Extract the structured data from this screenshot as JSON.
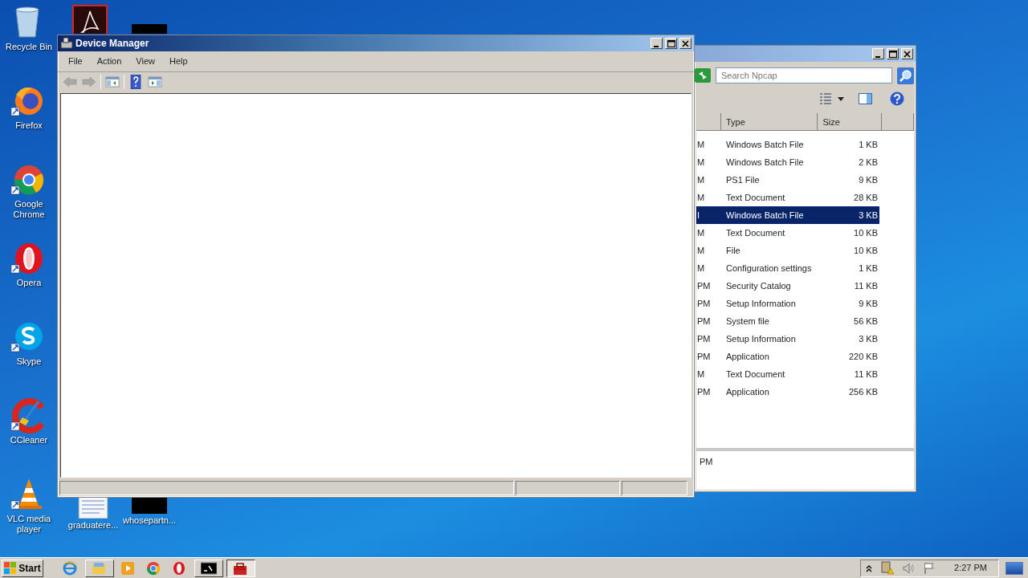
{
  "desktop_icons": [
    {
      "kind": "recycle",
      "label": "Recycle Bin"
    },
    {
      "kind": "firefox",
      "label": "Firefox"
    },
    {
      "kind": "chrome",
      "label": "Google Chrome"
    },
    {
      "kind": "opera",
      "label": "Opera"
    },
    {
      "kind": "skype",
      "label": "Skype"
    },
    {
      "kind": "ccleaner",
      "label": "CCleaner"
    },
    {
      "kind": "vlc",
      "label": "VLC media player"
    }
  ],
  "desktop_icons_2": [
    {
      "kind": "pdf"
    },
    {
      "kind": "thumb"
    },
    {
      "kind": "document",
      "label": "graduatere..."
    },
    {
      "kind": "thumb",
      "label": "whosepartn..."
    }
  ],
  "explorer": {
    "search": {
      "placeholder": "Search Npcap"
    },
    "columns": [
      "Type",
      "Size"
    ],
    "rows": [
      {
        "column_1": "M",
        "type": "Windows Batch File",
        "size": "1 KB",
        "selected": false
      },
      {
        "column_1": "M",
        "type": "Windows Batch File",
        "size": "2 KB",
        "selected": false
      },
      {
        "column_1": "M",
        "type": "PS1 File",
        "size": "9 KB",
        "selected": false
      },
      {
        "column_1": "M",
        "type": "Text Document",
        "size": "28 KB",
        "selected": false
      },
      {
        "column_1": "I",
        "type": "Windows Batch File",
        "size": "3 KB",
        "selected": true
      },
      {
        "column_1": "M",
        "type": "Text Document",
        "size": "10 KB",
        "selected": false
      },
      {
        "column_1": "M",
        "type": "File",
        "size": "10 KB",
        "selected": false
      },
      {
        "column_1": "M",
        "type": "Configuration settings",
        "size": "1 KB",
        "selected": false
      },
      {
        "column_1": "PM",
        "type": "Security Catalog",
        "size": "11 KB",
        "selected": false
      },
      {
        "column_1": "PM",
        "type": "Setup Information",
        "size": "9 KB",
        "selected": false
      },
      {
        "column_1": "PM",
        "type": "System file",
        "size": "56 KB",
        "selected": false
      },
      {
        "column_1": "PM",
        "type": "Setup Information",
        "size": "3 KB",
        "selected": false
      },
      {
        "column_1": "PM",
        "type": "Application",
        "size": "220 KB",
        "selected": false
      },
      {
        "column_1": "M",
        "type": "Text Document",
        "size": "11 KB",
        "selected": false
      },
      {
        "column_1": "PM",
        "type": "Application",
        "size": "256 KB",
        "selected": false
      }
    ],
    "details": "PM"
  },
  "device_manager": {
    "title": "Device Manager",
    "menu": [
      "File",
      "Action",
      "View",
      "Help"
    ],
    "toolbar": [
      {
        "kind": "back",
        "disabled": true
      },
      {
        "kind": "forward",
        "disabled": true
      },
      {
        "kind": "separator"
      },
      {
        "kind": "console-tree",
        "disabled": false
      },
      {
        "kind": "separator"
      },
      {
        "kind": "help",
        "disabled": false
      },
      {
        "kind": "action-pane",
        "disabled": false
      }
    ]
  },
  "taskbar": {
    "start": "Start",
    "items": [
      {
        "kind": "ie",
        "selected": false
      },
      {
        "kind": "explorer",
        "selected": false
      },
      {
        "kind": "media",
        "selected": false
      },
      {
        "kind": "chrome",
        "selected": false
      },
      {
        "kind": "opera",
        "selected": false
      },
      {
        "kind": "cmd",
        "selected": false
      },
      {
        "kind": "devmgr",
        "selected": true
      }
    ],
    "clock": "2:27 PM"
  }
}
